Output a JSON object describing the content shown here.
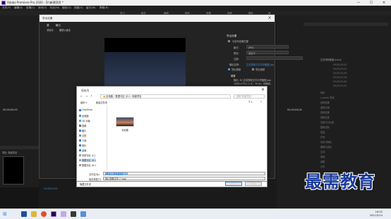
{
  "app": {
    "title": "Adobe Premiere Pro 2020 - D:\\新建项目 *",
    "window_controls": [
      "—",
      "☐",
      "✕"
    ]
  },
  "menubar": [
    "文件(F)",
    "编辑(E)",
    "剪辑(C)",
    "序列(S)",
    "标记(M)",
    "图形(G)",
    "视图(V)",
    "窗口(W)",
    "帮助(H)"
  ],
  "workspaces": [
    "学习",
    "组件",
    "编辑",
    "颜色",
    "效果",
    "音频",
    "图形",
    "库"
  ],
  "export_dialog": {
    "title": "导出设置",
    "tabs": [
      "源",
      "输出"
    ],
    "source_scaling_label": "源缩放:",
    "source_scaling_value": "缩放以适合",
    "section_title": "导出设置",
    "match_sequence": "与序列设置匹配",
    "format_label": "格式:",
    "format_value": "JPEG",
    "preset_label": "预设:",
    "preset_value": "自定义",
    "comment_label": "注释:",
    "output_name_label": "输出名称:",
    "output_name_value": "生成视频文件中的截图.jpg",
    "export_video": "导出视频",
    "export_audio": "导出音频",
    "summary_title": "摘要",
    "summary_output": "输出: D:\\生成视频文件中的截图.jpg",
    "summary_size": "1080x1920 (1.0), 30 fps, 帧编码...",
    "summary_none": "无音频"
  },
  "left_panel": {
    "timecode": "00;00;00;00",
    "project_label": "项目: 新建项目",
    "timecode_b": "00;00;01;00"
  },
  "right_panel": {
    "header": "生成视频截图.prproj",
    "timecode": "00;00;04;04",
    "items": [
      "00;00;00;00",
      "00;00;02;01",
      "00;00;05;09",
      "00;00;03;16",
      "00;00;00;00",
      "00;00;01;02"
    ],
    "effects": [
      "预设",
      "Lumetri 预设",
      "音频效果",
      "音频过渡",
      "视频效果",
      "视频过渡",
      "亮度与对比度",
      "图像控制",
      "扭曲",
      "时间",
      "杂色与颗粒",
      "模糊与锐化",
      "生成",
      "视频",
      "调整",
      "过时"
    ]
  },
  "saveas": {
    "title": "另存为",
    "breadcrumb": [
      "此电脑",
      "数据分区 (D:)",
      "新建项目"
    ],
    "search_placeholder": "搜索\"新建项目\"",
    "organize": "组织 ▾",
    "new_folder": "新建文件夹",
    "nav_items": [
      "OneDrive",
      "此电脑",
      "3D 对象",
      "视频",
      "图片",
      "文档",
      "下载",
      "音乐",
      "桌面",
      "系统分区 (C:)",
      "数据分区 (D:)",
      "数据分区 (D:)"
    ],
    "file_name": "无标题",
    "filename_label": "文件名(N):",
    "filename_value": "生成视频文件中的截图",
    "type_label": "保存类型(T):",
    "type_value": "静止图像文件 (*.jpg)",
    "hide_folders": "隐藏文件夹",
    "save_btn": "保存(S)",
    "cancel_btn": "取消"
  },
  "watermark": "最需教育",
  "taskbar": {
    "time": "16:52",
    "date": "2021/5/14"
  },
  "colors": {
    "accent": "#2f7ed8",
    "watermark": "#1a3a9c",
    "premiere_purple": "#9b6bff"
  }
}
